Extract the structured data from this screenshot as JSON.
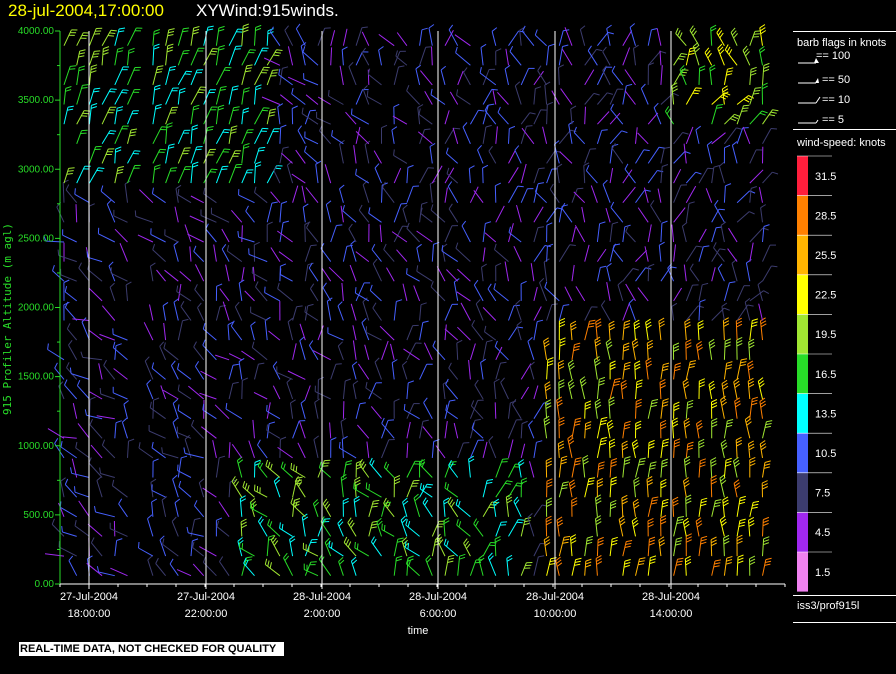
{
  "header": {
    "datetime": "28-jul-2004,17:00:00",
    "product": "XYWind:915winds."
  },
  "chart_data": {
    "type": "wind-barb profile time-height",
    "ylabel": "915 Profiler Altitude (m agl)",
    "xlabel": "time",
    "ylim": [
      0,
      4000
    ],
    "yticks": [
      "0.00",
      "500.00",
      "1000.00",
      "1500.00",
      "2000.00",
      "2500.00",
      "3000.00",
      "3500.00",
      "4000.00"
    ],
    "xticks": [
      {
        "date": "27-Jul-2004",
        "time": "18:00:00"
      },
      {
        "date": "27-Jul-2004",
        "time": "22:00:00"
      },
      {
        "date": "28-Jul-2004",
        "time": "2:00:00"
      },
      {
        "date": "28-Jul-2004",
        "time": "6:00:00"
      },
      {
        "date": "28-Jul-2004",
        "time": "10:00:00"
      },
      {
        "date": "28-Jul-2004",
        "time": "14:00:00"
      }
    ],
    "barb_legend_title": "barb flags in knots",
    "barb_flags": [
      "== 100",
      "== 50",
      "== 10",
      "== 5"
    ],
    "colorbar_title": "wind-speed: knots",
    "colorbar": [
      {
        "value": "31.5",
        "color": "#ff1e3c"
      },
      {
        "value": "28.5",
        "color": "#ff8000"
      },
      {
        "value": "25.5",
        "color": "#ffb400"
      },
      {
        "value": "22.5",
        "color": "#ffff00"
      },
      {
        "value": "19.5",
        "color": "#a0e632"
      },
      {
        "value": "16.5",
        "color": "#28dc28"
      },
      {
        "value": "13.5",
        "color": "#00ffff"
      },
      {
        "value": "10.5",
        "color": "#4660ff"
      },
      {
        "value": "7.5",
        "color": "#3c3c6e"
      },
      {
        "value": "4.5",
        "color": "#a028f0"
      },
      {
        "value": "1.5",
        "color": "#f082f0"
      }
    ]
  },
  "footer": {
    "quality_note": "REAL-TIME DATA, NOT CHECKED FOR QUALITY",
    "station": "iss3/prof915l"
  }
}
